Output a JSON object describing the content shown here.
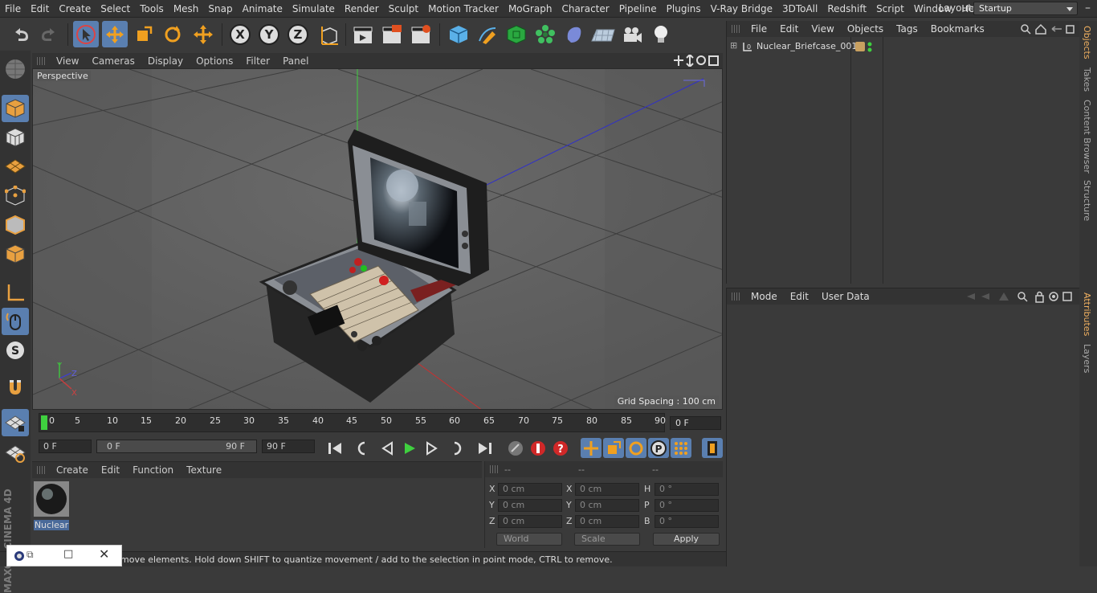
{
  "menubar": {
    "items": [
      "File",
      "Edit",
      "Create",
      "Select",
      "Tools",
      "Mesh",
      "Snap",
      "Animate",
      "Simulate",
      "Render",
      "Sculpt",
      "Motion Tracker",
      "MoGraph",
      "Character",
      "Pipeline",
      "Plugins",
      "V-Ray Bridge",
      "3DToAll",
      "Redshift",
      "Script",
      "Window",
      "Help"
    ],
    "layout_label": "Layout:",
    "layout_value": "Startup"
  },
  "viewport": {
    "menu": [
      "View",
      "Cameras",
      "Display",
      "Options",
      "Filter",
      "Panel"
    ],
    "camera_label": "Perspective",
    "grid_spacing": "Grid Spacing : 100 cm"
  },
  "timeline": {
    "ticks": [
      "0",
      "5",
      "10",
      "15",
      "20",
      "25",
      "30",
      "35",
      "40",
      "45",
      "50",
      "55",
      "60",
      "65",
      "70",
      "75",
      "80",
      "85",
      "90"
    ],
    "current_frame": "0 F",
    "start_field": "0 F",
    "range_start": "0 F",
    "range_end": "90 F",
    "end_field": "90 F"
  },
  "material_panel": {
    "menu": [
      "Create",
      "Edit",
      "Function",
      "Texture"
    ],
    "material_name": "Nuclear"
  },
  "coordinates": {
    "header": [
      "--",
      "--",
      "--"
    ],
    "rows": [
      {
        "pos_label": "X",
        "pos": "0 cm",
        "size_label": "X",
        "size": "0 cm",
        "rot_label": "H",
        "rot": "0 °"
      },
      {
        "pos_label": "Y",
        "pos": "0 cm",
        "size_label": "Y",
        "size": "0 cm",
        "rot_label": "P",
        "rot": "0 °"
      },
      {
        "pos_label": "Z",
        "pos": "0 cm",
        "size_label": "Z",
        "size": "0 cm",
        "rot_label": "B",
        "rot": "0 °"
      }
    ],
    "world": "World",
    "scale": "Scale",
    "apply": "Apply"
  },
  "objects_panel": {
    "menu": [
      "File",
      "Edit",
      "View",
      "Objects",
      "Tags",
      "Bookmarks"
    ],
    "object_name": "Nuclear_Briefcase_001",
    "tag_color": "#c8a060"
  },
  "attributes_panel": {
    "menu": [
      "Mode",
      "Edit",
      "User Data"
    ]
  },
  "side_tabs": [
    "Objects",
    "Takes",
    "Content Browser",
    "Structure",
    "Attributes",
    "Layers"
  ],
  "branding": "MAXON CINEMA 4D",
  "status_text": "move elements. Hold down SHIFT to quantize movement / add to the selection in point mode, CTRL to remove.",
  "colors": {
    "accent": "#5a7fb0",
    "active_tab": "#f0b060"
  }
}
